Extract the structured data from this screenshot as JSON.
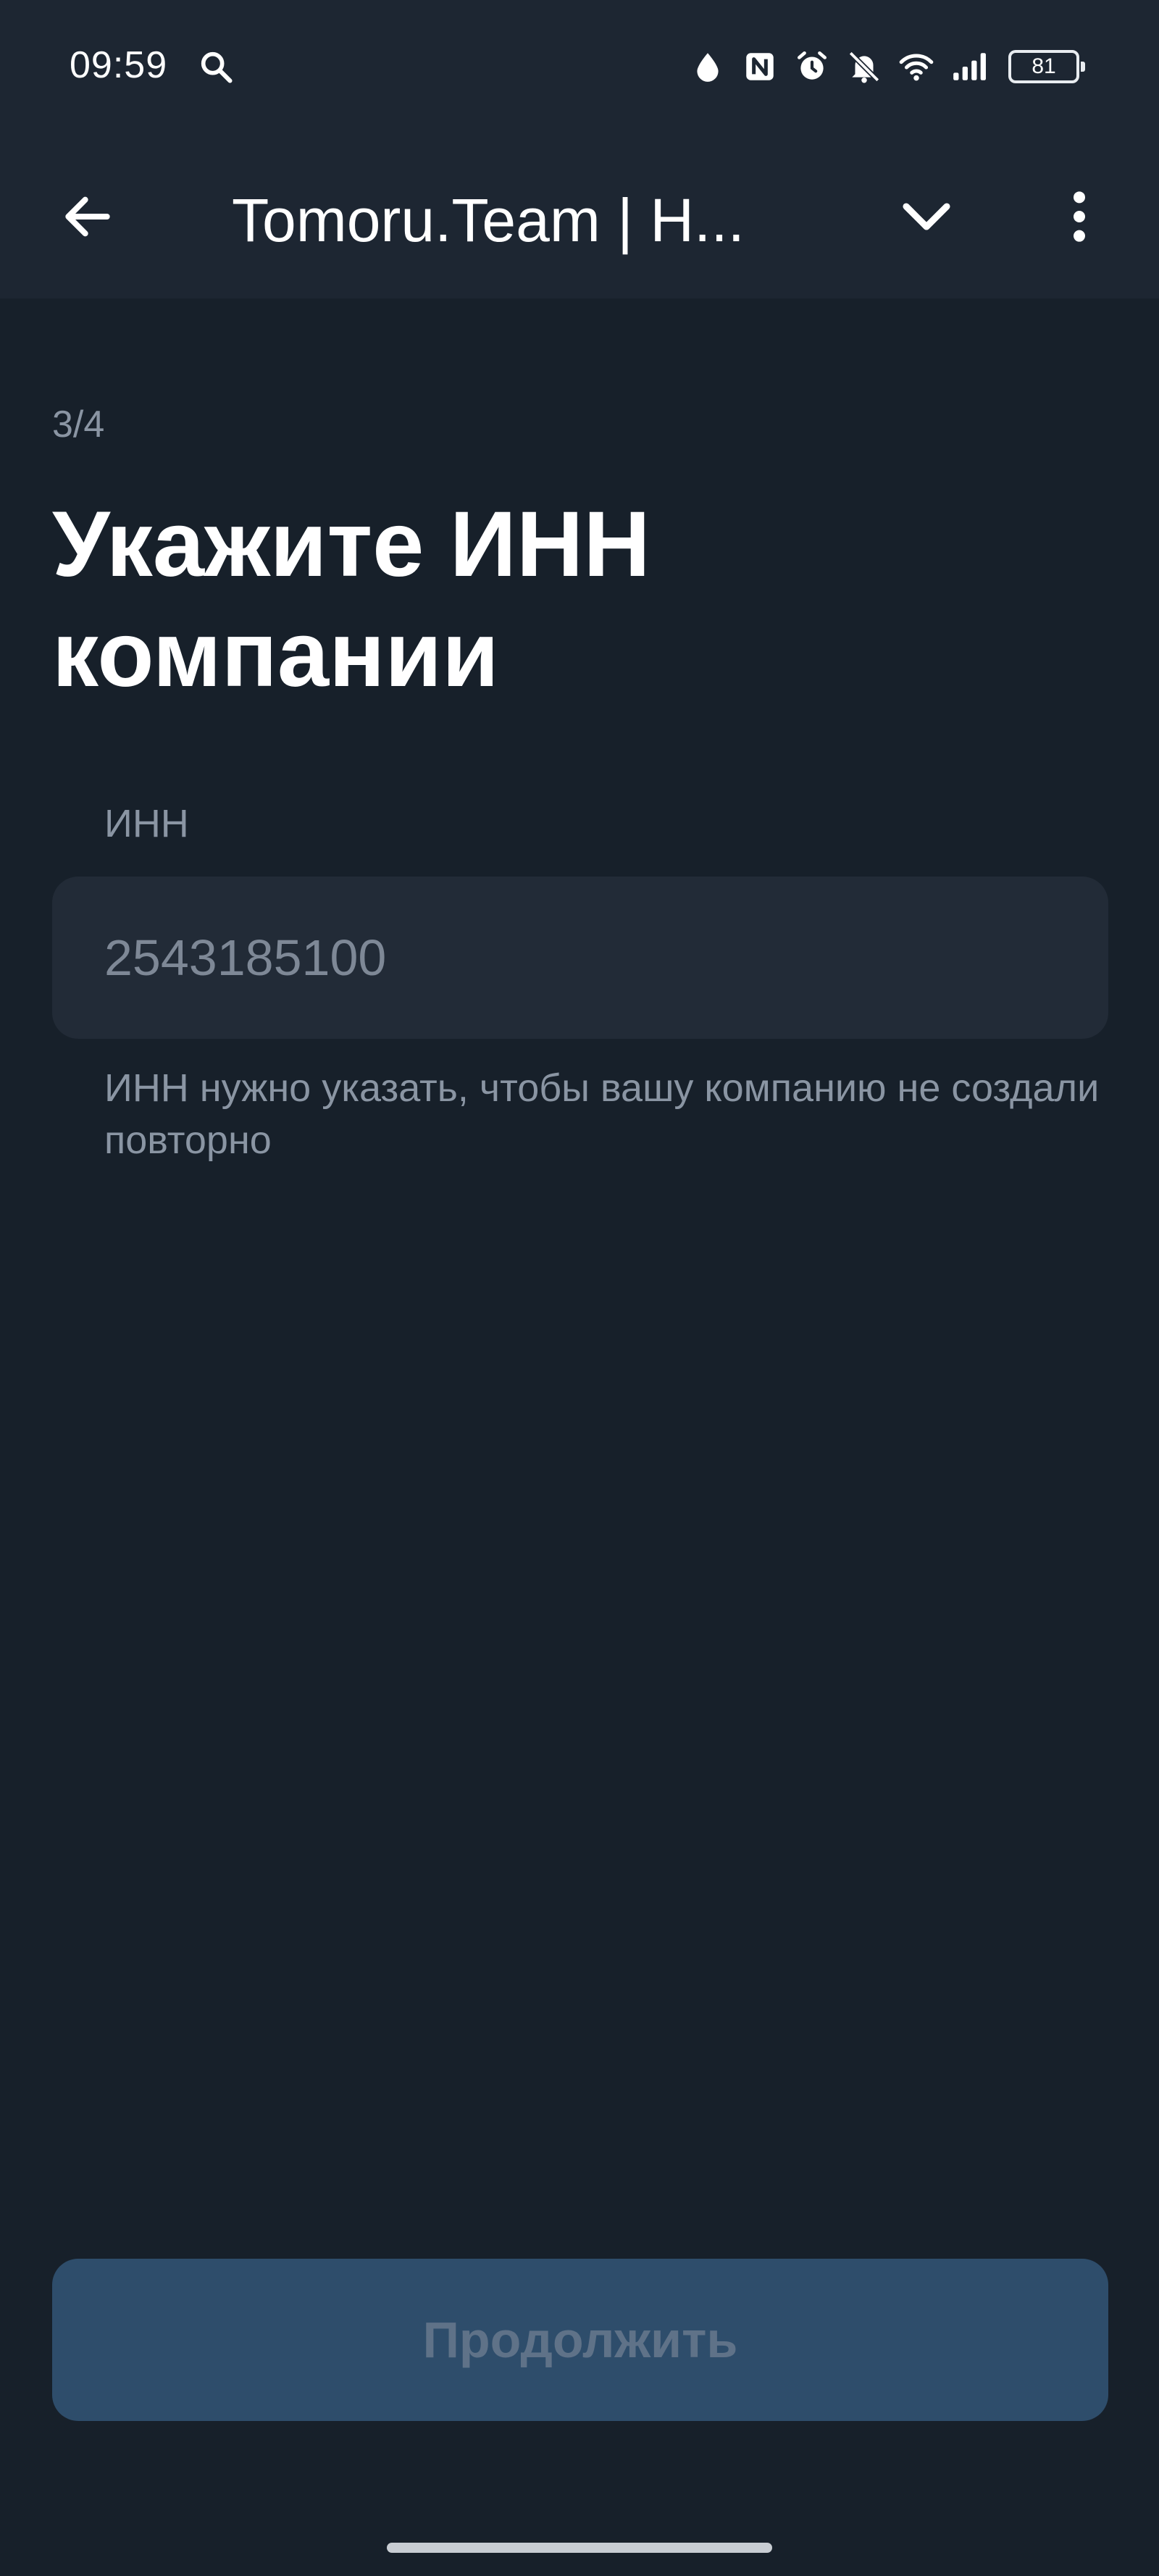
{
  "status_bar": {
    "time": "09:59",
    "battery": "81",
    "icons": [
      "search-icon",
      "drop-icon",
      "nfc-icon",
      "alarm-icon",
      "bell-muted-icon",
      "wifi-icon",
      "signal-icon",
      "battery-icon"
    ]
  },
  "app_bar": {
    "title": "Tomoru.Team | Н...",
    "back_icon": "arrow-left-icon",
    "expand_icon": "chevron-down-icon",
    "menu_icon": "more-vertical-icon"
  },
  "form": {
    "step": "3/4",
    "heading": "Укажите ИНН компании",
    "inn_label": "ИНН",
    "inn_placeholder": "2543185100",
    "inn_value": "",
    "hint": "ИНН нужно указать, чтобы вашу компанию не создали повторно"
  },
  "actions": {
    "continue_label": "Продолжить",
    "continue_enabled": false
  },
  "colors": {
    "background": "#17202a",
    "bar_background": "#1d2632",
    "input_background": "#222b37",
    "button_disabled_background": "#2e4d6b",
    "button_disabled_text": "#5f7288",
    "secondary_text": "#8a95a3"
  }
}
